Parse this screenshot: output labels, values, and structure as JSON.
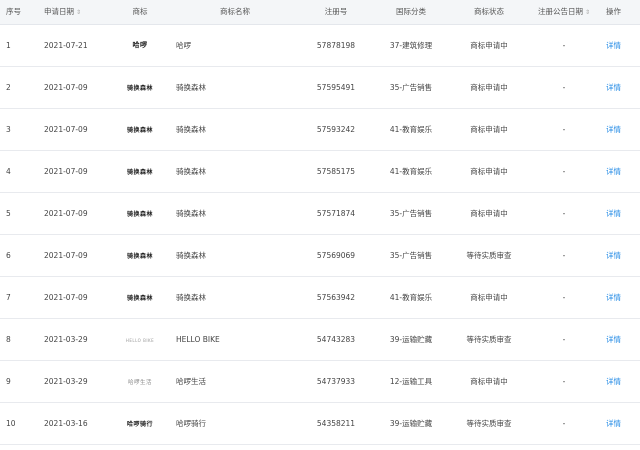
{
  "headers": {
    "index": "序号",
    "apply_date": "申请日期",
    "trademark": "商标",
    "name": "商标名称",
    "reg_no": "注册号",
    "class": "国际分类",
    "status": "商标状态",
    "announce_date": "注册公告日期",
    "action": "操作"
  },
  "sort_icon": "⇕",
  "rows": [
    {
      "index": "1",
      "apply_date": "2021-07-21",
      "logo": "哈啰",
      "name": "哈啰",
      "reg_no": "57878198",
      "class": "37-建筑修理",
      "status": "商标申请中",
      "announce": "-",
      "action": "详情"
    },
    {
      "index": "2",
      "apply_date": "2021-07-09",
      "logo": "骑换森林",
      "name": "骑换森林",
      "reg_no": "57595491",
      "class": "35-广告销售",
      "status": "商标申请中",
      "announce": "-",
      "action": "详情"
    },
    {
      "index": "3",
      "apply_date": "2021-07-09",
      "logo": "骑换森林",
      "name": "骑换森林",
      "reg_no": "57593242",
      "class": "41-教育娱乐",
      "status": "商标申请中",
      "announce": "-",
      "action": "详情"
    },
    {
      "index": "4",
      "apply_date": "2021-07-09",
      "logo": "骑换森林",
      "name": "骑换森林",
      "reg_no": "57585175",
      "class": "41-教育娱乐",
      "status": "商标申请中",
      "announce": "-",
      "action": "详情"
    },
    {
      "index": "5",
      "apply_date": "2021-07-09",
      "logo": "骑换森林",
      "name": "骑换森林",
      "reg_no": "57571874",
      "class": "35-广告销售",
      "status": "商标申请中",
      "announce": "-",
      "action": "详情"
    },
    {
      "index": "6",
      "apply_date": "2021-07-09",
      "logo": "骑换森林",
      "name": "骑换森林",
      "reg_no": "57569069",
      "class": "35-广告销售",
      "status": "等待实质审查",
      "announce": "-",
      "action": "详情"
    },
    {
      "index": "7",
      "apply_date": "2021-07-09",
      "logo": "骑换森林",
      "name": "骑换森林",
      "reg_no": "57563942",
      "class": "41-教育娱乐",
      "status": "商标申请中",
      "announce": "-",
      "action": "详情"
    },
    {
      "index": "8",
      "apply_date": "2021-03-29",
      "logo": "HELLO BIKE",
      "name": "HELLO BIKE",
      "reg_no": "54743283",
      "class": "39-运输贮藏",
      "status": "等待实质审查",
      "announce": "-",
      "action": "详情"
    },
    {
      "index": "9",
      "apply_date": "2021-03-29",
      "logo": "哈啰生活",
      "name": "哈啰生活",
      "reg_no": "54737933",
      "class": "12-运输工具",
      "status": "商标申请中",
      "announce": "-",
      "action": "详情"
    },
    {
      "index": "10",
      "apply_date": "2021-03-16",
      "logo": "哈啰骑行",
      "name": "哈啰骑行",
      "reg_no": "54358211",
      "class": "39-运输贮藏",
      "status": "等待实质审查",
      "announce": "-",
      "action": "详情"
    }
  ],
  "colors": {
    "header_bg": "#f4f6f8",
    "link": "#1e88e5",
    "border": "#e8eaee"
  }
}
